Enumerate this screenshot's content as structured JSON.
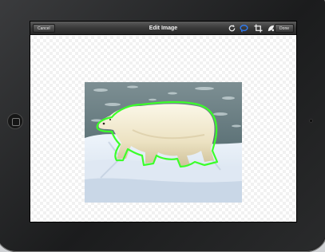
{
  "navbar": {
    "cancel_label": "Cancel",
    "title": "Edit Image",
    "done_label": "Done",
    "tools": [
      "rotate-icon",
      "lasso-icon",
      "crop-icon",
      "enhance-icon"
    ]
  },
  "colors": {
    "navbar": "#2e2e2e",
    "lasso_selection": "#3bff2a",
    "lasso_tool_active": "#2f7cf6"
  }
}
